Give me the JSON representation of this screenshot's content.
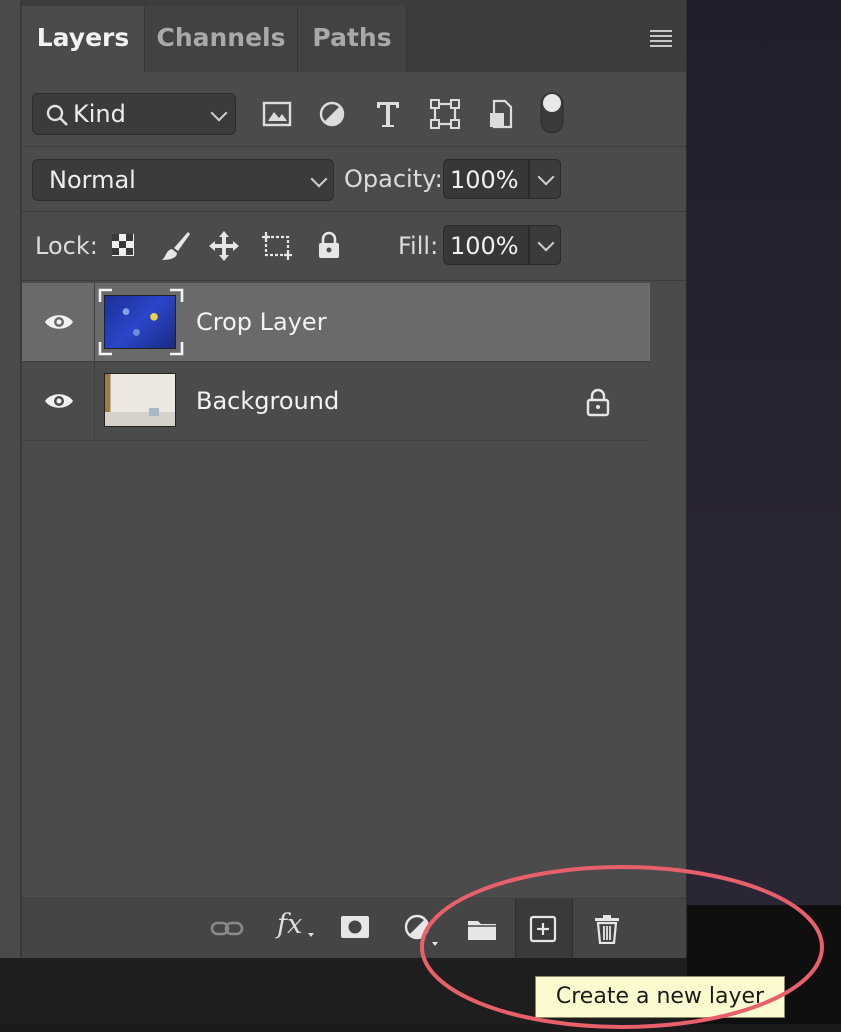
{
  "tabs": [
    {
      "label": "Layers",
      "active": true
    },
    {
      "label": "Channels",
      "active": false
    },
    {
      "label": "Paths",
      "active": false
    }
  ],
  "filter": {
    "kind_label": "Kind",
    "filter_icons": [
      "image-filter-icon",
      "adjustment-filter-icon",
      "type-filter-icon",
      "shape-filter-icon",
      "smart-object-filter-icon",
      "filter-toggle-icon"
    ]
  },
  "blend": {
    "mode": "Normal",
    "opacity_label": "Opacity:",
    "opacity_value": "100%"
  },
  "lock": {
    "label": "Lock:",
    "icons": [
      "lock-transparent-pixels-icon",
      "lock-image-pixels-icon",
      "lock-position-icon",
      "lock-artboard-icon",
      "lock-all-icon"
    ],
    "fill_label": "Fill:",
    "fill_value": "100%"
  },
  "layers": [
    {
      "name": "Crop Layer",
      "visible": true,
      "selected": true,
      "locked": false
    },
    {
      "name": "Background",
      "visible": true,
      "selected": false,
      "locked": true
    }
  ],
  "bottom_bar": {
    "icons": [
      "link-layers-icon",
      "fx-icon",
      "layer-mask-icon",
      "adjustment-layer-icon",
      "new-group-icon",
      "new-layer-icon",
      "delete-layer-icon"
    ],
    "fx_label": "fx"
  },
  "tooltip": {
    "text": "Create a new layer"
  },
  "colors": {
    "highlight": "#e8606a",
    "selected_row": "#6a6a6a",
    "panel": "#4b4b4b"
  }
}
